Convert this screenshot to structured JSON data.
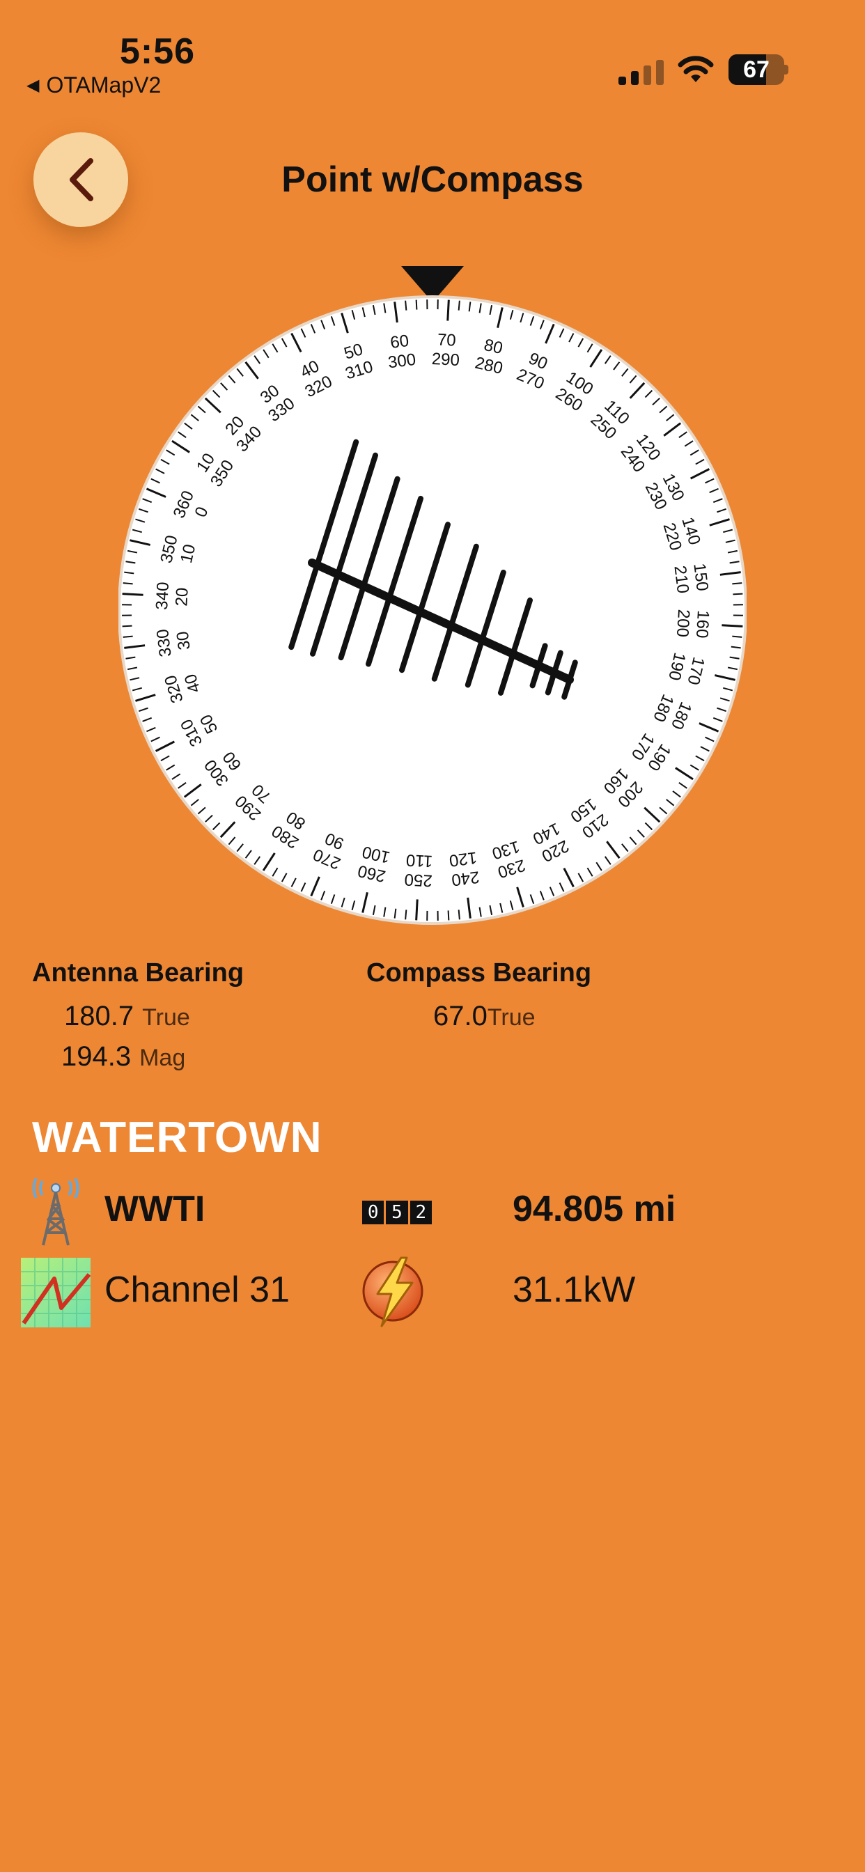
{
  "status_bar": {
    "time": "5:56",
    "back_app": "OTAMapV2",
    "battery_level": "67",
    "battery_fraction": 0.67,
    "signal_bars_active": 2
  },
  "nav": {
    "title": "Point w/Compass",
    "back_icon": "chevron-left-icon"
  },
  "compass": {
    "pointer_icon": "triangle-down-icon",
    "antenna_icon": "yagi-antenna-icon",
    "outer_labels": [
      "360",
      "10",
      "20",
      "30",
      "40",
      "50",
      "60",
      "70",
      "80",
      "90",
      "100",
      "110",
      "120",
      "130",
      "140",
      "150",
      "160",
      "170",
      "180",
      "190",
      "200",
      "210",
      "220",
      "230",
      "240",
      "250",
      "260",
      "270",
      "280",
      "290",
      "300",
      "310",
      "320",
      "330",
      "340",
      "350"
    ],
    "inner_labels": [
      "0",
      "350",
      "340",
      "330",
      "320",
      "310",
      "300",
      "290",
      "280",
      "270",
      "260",
      "250",
      "240",
      "230",
      "220",
      "210",
      "200",
      "190",
      "180",
      "170",
      "160",
      "150",
      "140",
      "130",
      "120",
      "110",
      "100",
      "90",
      "80",
      "70",
      "60",
      "50",
      "40",
      "30",
      "20",
      "10"
    ]
  },
  "antenna_bearing": {
    "label": "Antenna Bearing",
    "true_value": "180.7",
    "true_unit": "True",
    "mag_value": "194.3",
    "mag_unit": "Mag"
  },
  "compass_bearing": {
    "label": "Compass Bearing",
    "true_value": "67.0",
    "true_unit": "True"
  },
  "station": {
    "city": "WATERTOWN",
    "callsign": "WWTI",
    "tower_icon": "radio-tower-icon",
    "odometer": [
      "0",
      "5",
      "2"
    ],
    "odometer_icon": "odometer-icon",
    "distance": "94.805 mi",
    "channel_icon": "signal-graph-icon",
    "channel": "Channel 31",
    "power_icon": "lightning-icon",
    "power": "31.1kW"
  },
  "colors": {
    "background": "#EE8733",
    "back_button": "#F8D59E",
    "dial": "#FFFFFF",
    "text": "#111111",
    "city": "#FFFFFF"
  }
}
